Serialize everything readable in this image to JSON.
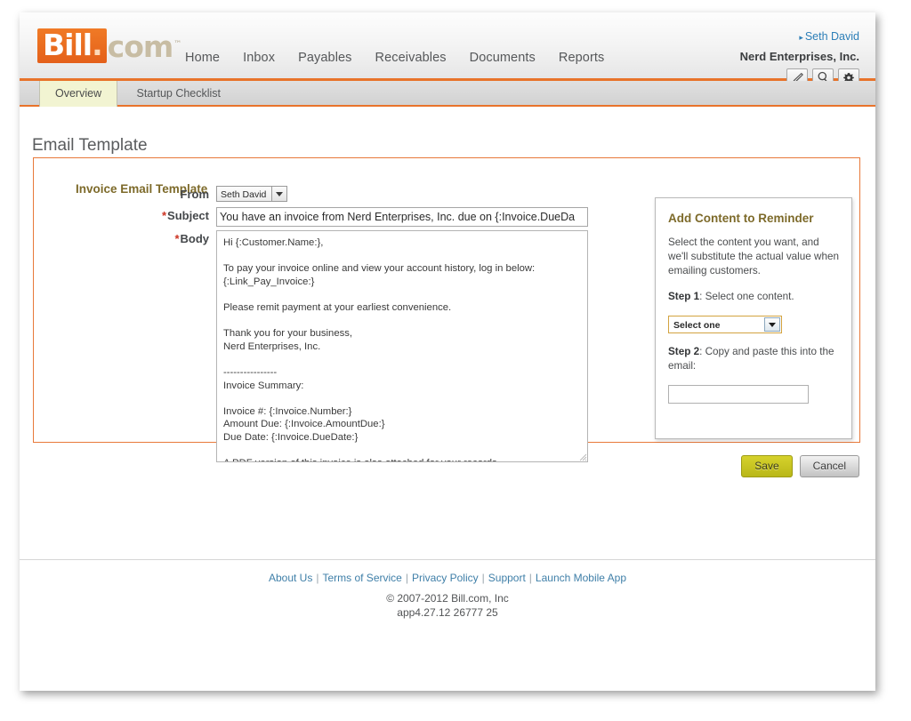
{
  "brand": {
    "logo_main": "Bill",
    "logo_dot": ".",
    "logo_suffix": "com",
    "logo_tm": "™",
    "accent_orange": "#e8732a",
    "accent_link_blue": "#2d7fb8",
    "heading_olive": "#7d6a2a",
    "required_red": "#cc3322"
  },
  "header": {
    "nav": [
      {
        "label": "Home",
        "name": "nav-home"
      },
      {
        "label": "Inbox",
        "name": "nav-inbox"
      },
      {
        "label": "Payables",
        "name": "nav-payables"
      },
      {
        "label": "Receivables",
        "name": "nav-receivables"
      },
      {
        "label": "Documents",
        "name": "nav-documents"
      },
      {
        "label": "Reports",
        "name": "nav-reports"
      }
    ],
    "user_caret": "▸",
    "user_name": "Seth David",
    "company_name": "Nerd Enterprises, Inc.",
    "icons": [
      {
        "name": "pencil-icon",
        "title": "Edit"
      },
      {
        "name": "search-icon",
        "title": "Search"
      },
      {
        "name": "gear-icon",
        "title": "Settings"
      }
    ]
  },
  "tabs": [
    {
      "label": "Overview",
      "name": "tab-overview",
      "active": true
    },
    {
      "label": "Startup Checklist",
      "name": "tab-startup-checklist",
      "active": false
    }
  ],
  "page": {
    "title": "Email Template"
  },
  "form": {
    "heading": "Invoice Email Template",
    "from": {
      "label": "From",
      "value": "Seth David",
      "required": false
    },
    "subject": {
      "label": "Subject",
      "required_mark": "*",
      "value": "You have an invoice from Nerd Enterprises, Inc. due on {:Invoice.DueDa"
    },
    "body": {
      "label": "Body",
      "required_mark": "*",
      "value": "Hi {:Customer.Name:},\n\nTo pay your invoice online and view your account history, log in below:\n{:Link_Pay_Invoice:}\n\nPlease remit payment at your earliest convenience.\n\nThank you for your business,\nNerd Enterprises, Inc.\n\n----------------\nInvoice Summary:\n\nInvoice #: {:Invoice.Number:}\nAmount Due: {:Invoice.AmountDue:}\nDue Date: {:Invoice.DueDate:}\n\nA PDF version of this invoice is also attached for your records."
    }
  },
  "sidebox": {
    "title": "Add Content to Reminder",
    "intro": "Select the content you want, and we'll substitute the actual value when emailing customers.",
    "step1_num": "Step 1",
    "step1_text": ": Select one content.",
    "select_value": "Select one",
    "step2_num": "Step 2",
    "step2_text": ": Copy and paste this into the email:",
    "paste_value": "",
    "paste_placeholder": ""
  },
  "actions": {
    "save_label": "Save",
    "cancel_label": "Cancel"
  },
  "footer": {
    "links": [
      {
        "label": "About Us",
        "name": "footer-link-about-us"
      },
      {
        "label": "Terms of Service",
        "name": "footer-link-terms-of-service"
      },
      {
        "label": "Privacy Policy",
        "name": "footer-link-privacy-policy"
      },
      {
        "label": "Support",
        "name": "footer-link-support"
      },
      {
        "label": "Launch Mobile App",
        "name": "footer-link-launch-mobile-app"
      }
    ],
    "separator": "|",
    "copyright": "© 2007-2012 Bill.com, Inc",
    "build_version": "app4.27.12 26777 25"
  }
}
